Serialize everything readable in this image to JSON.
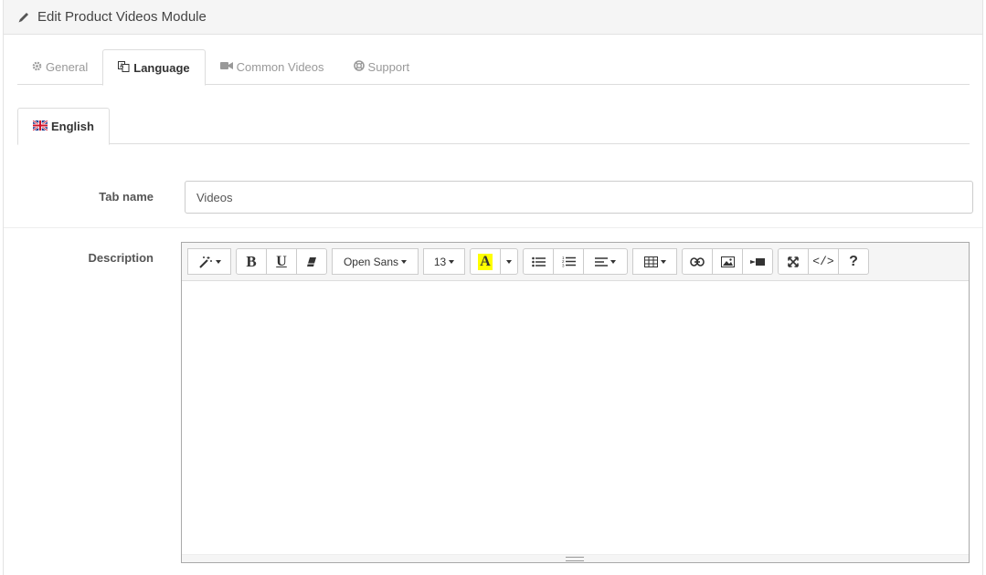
{
  "header": {
    "title": "Edit Product Videos Module",
    "icon": "pencil-icon"
  },
  "tabs": [
    {
      "label": "General",
      "icon": "gear-icon",
      "active": false
    },
    {
      "label": "Language",
      "icon": "language-icon",
      "active": true
    },
    {
      "label": "Common Videos",
      "icon": "video-camera-icon",
      "active": false
    },
    {
      "label": "Support",
      "icon": "lifebuoy-icon",
      "active": false
    }
  ],
  "language_tabs": [
    {
      "label": "English",
      "icon": "uk-flag-icon",
      "active": true
    }
  ],
  "form": {
    "tab_name_label": "Tab name",
    "tab_name_value": "Videos",
    "description_label": "Description"
  },
  "editor": {
    "font_family": "Open Sans",
    "font_size": "13",
    "color_button_letter": "A",
    "highlight_color": "#ffff00",
    "content": ""
  }
}
